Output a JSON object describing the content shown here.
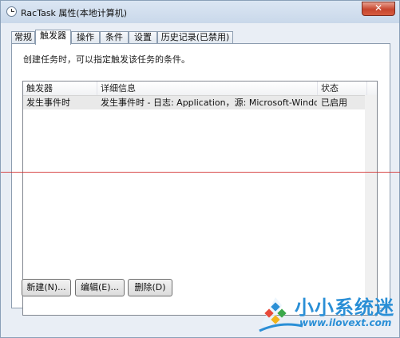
{
  "window": {
    "title": "RacTask 属性(本地计算机)",
    "close": "✕"
  },
  "tabs": [
    {
      "label": "常规"
    },
    {
      "label": "触发器"
    },
    {
      "label": "操作"
    },
    {
      "label": "条件"
    },
    {
      "label": "设置"
    },
    {
      "label": "历史记录(已禁用)"
    }
  ],
  "panel": {
    "hint": "创建任务时，可以指定触发该任务的条件。",
    "columns": [
      "触发器",
      "详细信息",
      "状态"
    ],
    "rows": [
      {
        "trigger": "发生事件时",
        "details": "发生事件时 - 日志: Application，源: Microsoft-Windows-CEI...",
        "status": "已启用"
      }
    ]
  },
  "buttons": {
    "new": "新建(N)...",
    "edit": "编辑(E)...",
    "delete": "删除(D)"
  },
  "watermark": {
    "title": "小小系统迷",
    "url": "www.ilovext.com"
  },
  "colors": {
    "accent": "#2a8fd6",
    "close": "#c7452e",
    "divider": "#d12b2b"
  }
}
